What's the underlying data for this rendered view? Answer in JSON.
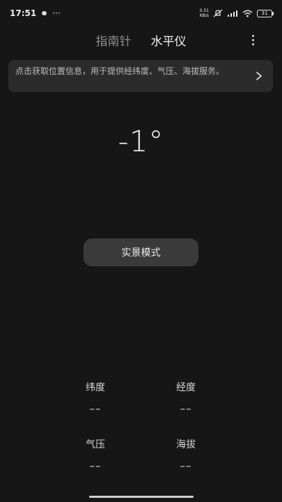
{
  "status_bar": {
    "time": "17:51",
    "more": "···",
    "net_speed_value": "0.51",
    "net_speed_unit": "KB/s",
    "battery": "31"
  },
  "header": {
    "tabs": [
      {
        "label": "指南针",
        "active": false
      },
      {
        "label": "水平仪",
        "active": true
      }
    ]
  },
  "banner": {
    "text": "点击获取位置信息，用于提供经纬度、气压、海拔服务。"
  },
  "angle": {
    "value": "-1°"
  },
  "scene_button": {
    "label": "实景模式"
  },
  "info": {
    "latitude": {
      "label": "纬度",
      "value": "––"
    },
    "longitude": {
      "label": "经度",
      "value": "––"
    },
    "pressure": {
      "label": "气压",
      "value": "––"
    },
    "altitude": {
      "label": "海拔",
      "value": "––"
    }
  }
}
